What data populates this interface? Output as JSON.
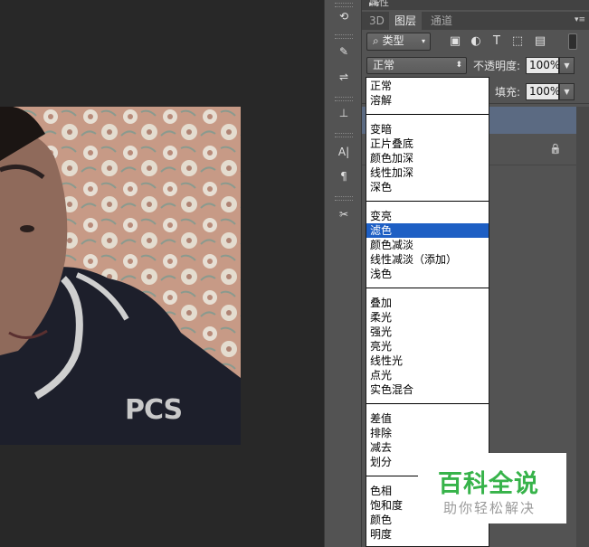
{
  "panel": {
    "title": "属性",
    "tabs": [
      {
        "label": "3D",
        "active": false
      },
      {
        "label": "图层",
        "active": true
      },
      {
        "label": "通道",
        "active": false
      }
    ],
    "filter_kind": "类型",
    "filter_search_glyph": "⌕",
    "blend_mode": "正常",
    "opacity_label": "不透明度:",
    "opacity_value": "100%",
    "fill_label": "填充:",
    "fill_value": "100%",
    "lock_glyph": "🔒"
  },
  "blend_list": {
    "selected": "滤色",
    "groups": [
      [
        "正常",
        "溶解"
      ],
      [
        "变暗",
        "正片叠底",
        "颜色加深",
        "线性加深",
        "深色"
      ],
      [
        "变亮",
        "滤色",
        "颜色减淡",
        "线性减淡（添加）",
        "浅色"
      ],
      [
        "叠加",
        "柔光",
        "强光",
        "亮光",
        "线性光",
        "点光",
        "实色混合"
      ],
      [
        "差值",
        "排除",
        "减去",
        "划分"
      ],
      [
        "色相",
        "饱和度",
        "颜色",
        "明度"
      ]
    ]
  },
  "tools": [
    {
      "name": "history-brush-icon",
      "glyph": "⟲"
    },
    {
      "name": "brush-settings-icon",
      "glyph": "✎"
    },
    {
      "name": "adjustments-icon",
      "glyph": "⇌"
    },
    {
      "name": "clone-stamp-icon",
      "glyph": "⊥"
    },
    {
      "name": "character-icon",
      "glyph": "A|"
    },
    {
      "name": "paragraph-icon",
      "glyph": "¶"
    },
    {
      "name": "tool-presets-icon",
      "glyph": "✂"
    }
  ],
  "photo": {
    "shirt_text": "PCS"
  },
  "watermark": {
    "title": "百科全说",
    "subtitle": "助你轻松解决"
  },
  "colors": {
    "selection": "#1e5fc4",
    "watermark_green": "#37b34a",
    "layer_highlight": "#5b6a82"
  }
}
